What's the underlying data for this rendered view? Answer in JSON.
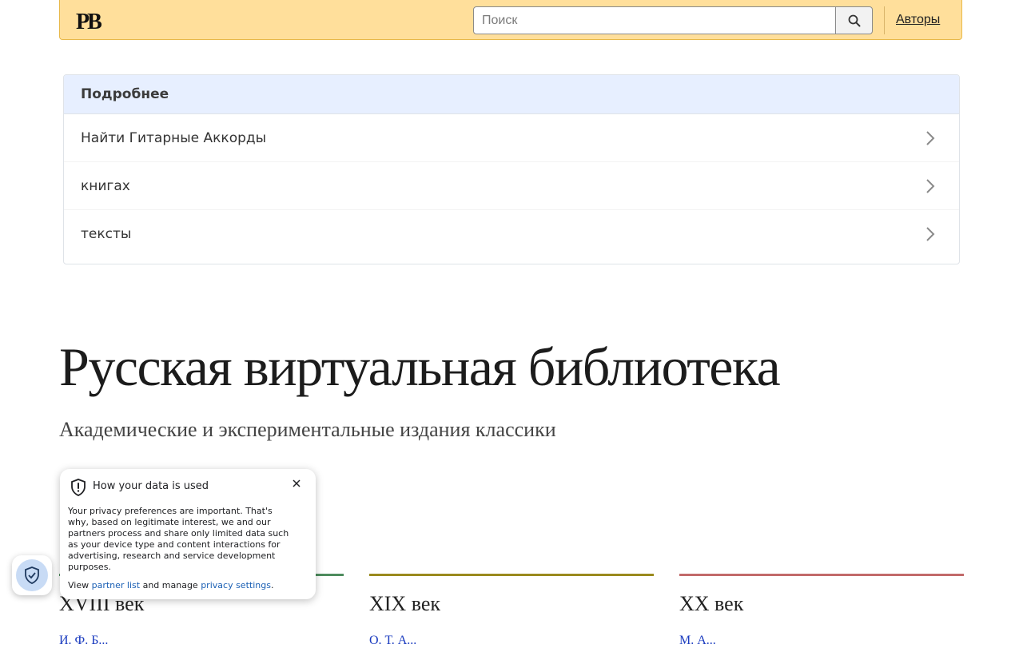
{
  "header": {
    "logo_text": "РВ",
    "search_placeholder": "Поиск",
    "search_button_icon": "search-icon",
    "authors_link": "Авторы",
    "background_color": "#ffdf9b",
    "border_color": "#e8b94a"
  },
  "panel": {
    "heading": "Подробнее",
    "heading_background": "#e7efff",
    "items": [
      {
        "label": "Найти Гитарные Аккорды",
        "icon": "chevron-right-icon"
      },
      {
        "label": "книгах",
        "icon": "chevron-right-icon"
      },
      {
        "label": "тексты",
        "icon": "chevron-right-icon"
      }
    ]
  },
  "hero": {
    "title": "Русская виртуальная библиотека",
    "subtitle": "Академические и экспериментальные издания классики"
  },
  "centuries": [
    {
      "title": "XVIII век",
      "author": "И. Ф. Б...",
      "color": "#4e8c5e"
    },
    {
      "title": "XIX век",
      "author": "О. Т. А...",
      "color": "#9a8a1e"
    },
    {
      "title": "XX век",
      "author": "М. А...",
      "color": "#c26a6a"
    }
  ],
  "privacy": {
    "title": "How your data is used",
    "body": "Your privacy preferences are important. That's why, based on legitimate interest, we and our partners process and share only limited data such as your device type and content interactions for advertising, research and service development purposes.",
    "footer_prefix": "View ",
    "partner_link": "partner list",
    "footer_middle": " and manage ",
    "settings_link": "privacy settings",
    "footer_suffix": ".",
    "badge_icon": "shield-check-icon"
  }
}
